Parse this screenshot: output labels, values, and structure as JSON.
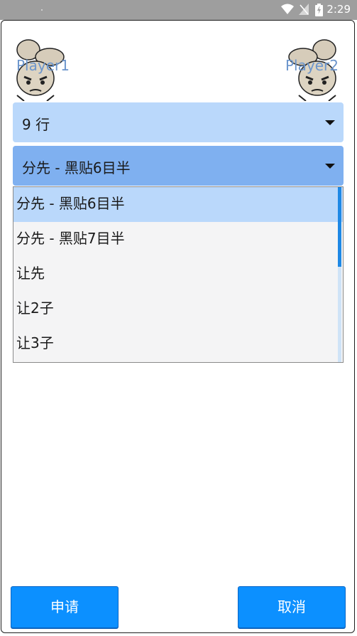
{
  "status_bar": {
    "time": "2:29",
    "icons": [
      "wifi-icon",
      "signal-off-icon",
      "battery-icon"
    ]
  },
  "players": {
    "left_label": "Player1",
    "right_label": "Player2"
  },
  "rows_select": {
    "value": "9 行"
  },
  "handicap_select": {
    "value": "分先 - 黑贴6目半",
    "options": [
      "分先 - 黑贴6目半",
      "分先 - 黑贴7目半",
      "让先",
      "让2子",
      "让3子"
    ],
    "selected_index": 0
  },
  "buttons": {
    "apply": "申请",
    "cancel": "取消"
  },
  "colors": {
    "status_bar": "#9e9e9e",
    "select_light": "#bad8fb",
    "select_active": "#7fb0f0",
    "button": "#0c90ff",
    "player_label": "#6b95cc"
  }
}
